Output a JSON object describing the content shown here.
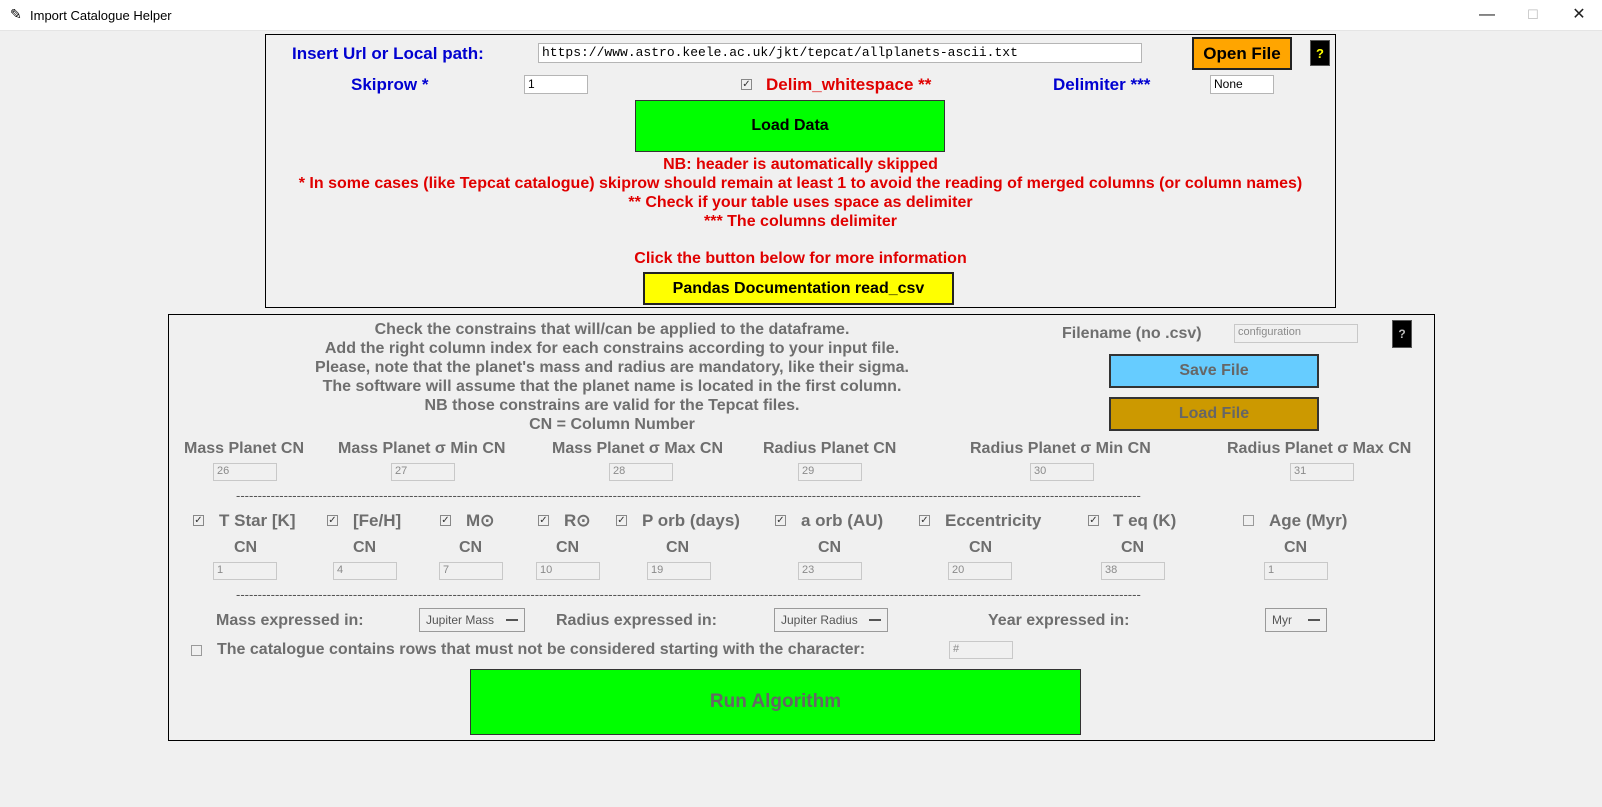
{
  "window": {
    "title": "Import Catalogue Helper"
  },
  "top": {
    "url_label": "Insert Url or Local path:",
    "url_value": "https://www.astro.keele.ac.uk/jkt/tepcat/allplanets-ascii.txt",
    "open_file": "Open File",
    "help": "?",
    "skiprow_label": "Skiprow *",
    "skiprow_value": "1",
    "delim_ws_label": "Delim_whitespace **",
    "delim_ws_checked": true,
    "delimiter_label": "Delimiter ***",
    "delimiter_value": "None",
    "load_data": "Load Data",
    "notes": [
      "NB: header is automatically skipped",
      "* In some cases (like Tepcat catalogue) skiprow should remain at least 1 to avoid the reading of merged columns (or column names)",
      "** Check if your table uses space as delimiter",
      "*** The columns delimiter",
      "Click the button below for more information"
    ],
    "pandas_button": "Pandas Documentation read_csv"
  },
  "bottom": {
    "instructions": [
      "Check the constrains that will/can be applied to the dataframe.",
      "Add the right column index for each constrains according to your input file.",
      "Please, note that the planet's mass and radius are mandatory, like their sigma.",
      "The software will assume that the planet name is located in the first column.",
      "NB those constrains are valid for the Tepcat files.",
      "CN = Column Number"
    ],
    "filename_label": "Filename (no .csv)",
    "filename_value": "configuration",
    "help": "?",
    "save_file": "Save File",
    "load_file": "Load File",
    "mandatory": [
      {
        "label": "Mass Planet CN",
        "value": "26"
      },
      {
        "label": "Mass Planet σ Min CN",
        "value": "27"
      },
      {
        "label": "Mass Planet σ Max CN",
        "value": "28"
      },
      {
        "label": "Radius Planet CN",
        "value": "29"
      },
      {
        "label": "Radius Planet σ Min CN",
        "value": "30"
      },
      {
        "label": "Radius Planet σ Max CN",
        "value": "31"
      }
    ],
    "separator": "-----------------------------------------------------------------------------------------------------------------------------------------------------------------------------------------------------------------",
    "optional": [
      {
        "label": "T Star [K]",
        "checked": true,
        "cn": "CN",
        "value": "1"
      },
      {
        "label": "[Fe/H]",
        "checked": true,
        "cn": "CN",
        "value": "4"
      },
      {
        "label": "M⊙",
        "checked": true,
        "cn": "CN",
        "value": "7"
      },
      {
        "label": "R⊙",
        "checked": true,
        "cn": "CN",
        "value": "10"
      },
      {
        "label": "P orb (days)",
        "checked": true,
        "cn": "CN",
        "value": "19"
      },
      {
        "label": "a orb (AU)",
        "checked": true,
        "cn": "CN",
        "value": "23"
      },
      {
        "label": "Eccentricity",
        "checked": true,
        "cn": "CN",
        "value": "20"
      },
      {
        "label": "T eq (K)",
        "checked": true,
        "cn": "CN",
        "value": "38"
      },
      {
        "label": "Age (Myr)",
        "checked": false,
        "cn": "CN",
        "value": "1"
      }
    ],
    "mass_label": "Mass expressed in:",
    "mass_value": "Jupiter Mass",
    "radius_label": "Radius expressed in:",
    "radius_value": "Jupiter Radius",
    "year_label": "Year expressed in:",
    "year_value": "Myr",
    "comment_label": "The catalogue contains rows that must not be considered starting with the character:",
    "comment_checked": false,
    "comment_value": "#",
    "run": "Run Algorithm"
  },
  "colors": {
    "green": "#00ff00",
    "yellow": "#ffff00",
    "orange": "#ffa500",
    "light_blue": "#66ccff",
    "dark_gold": "#cc9900",
    "blue_text": "#0000d0",
    "red_text": "#e00000"
  }
}
